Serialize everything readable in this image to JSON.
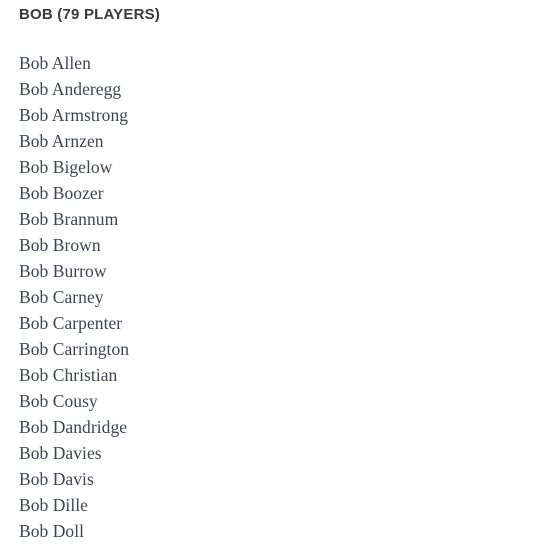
{
  "page": {
    "background_color": "#ffffff",
    "heading_color": "#3a3a3c",
    "list_text_color": "#3f444d"
  },
  "group": {
    "letter_name": "Bob",
    "player_count": 79,
    "heading": "BOB (79 PLAYERS)"
  },
  "players": [
    {
      "name": "Bob Allen"
    },
    {
      "name": "Bob Anderegg"
    },
    {
      "name": "Bob Armstrong"
    },
    {
      "name": "Bob Arnzen"
    },
    {
      "name": "Bob Bigelow"
    },
    {
      "name": "Bob Boozer"
    },
    {
      "name": "Bob Brannum"
    },
    {
      "name": "Bob Brown"
    },
    {
      "name": "Bob Burrow"
    },
    {
      "name": "Bob Carney"
    },
    {
      "name": "Bob Carpenter"
    },
    {
      "name": "Bob Carrington"
    },
    {
      "name": "Bob Christian"
    },
    {
      "name": "Bob Cousy"
    },
    {
      "name": "Bob Dandridge"
    },
    {
      "name": "Bob Davies"
    },
    {
      "name": "Bob Davis"
    },
    {
      "name": "Bob Dille"
    },
    {
      "name": "Bob Doll"
    }
  ]
}
